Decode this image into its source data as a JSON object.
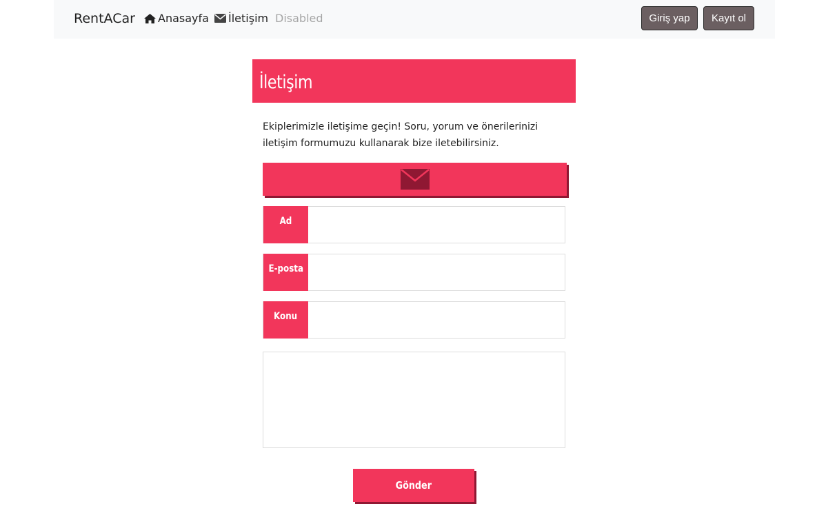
{
  "navbar": {
    "brand": "RentACar",
    "links": [
      {
        "label": "Anasayfa",
        "icon": "home-icon"
      },
      {
        "label": "İletişim",
        "icon": "envelope-icon"
      },
      {
        "label": "Disabled"
      }
    ],
    "login_label": "Giriş yap",
    "register_label": "Kayıt ol"
  },
  "page": {
    "title": "İletişim",
    "intro": "Ekiplerimizle iletişime geçin! Soru, yorum ve önerilerinizi iletişim formumuzu kullanarak bize iletebilirsiniz.",
    "mail_icon": "envelope-icon"
  },
  "form": {
    "fields": [
      {
        "label": "Ad",
        "value": ""
      },
      {
        "label": "E-posta",
        "value": ""
      },
      {
        "label": "Konu",
        "value": ""
      }
    ],
    "message_value": "",
    "submit_label": "Gönder"
  },
  "colors": {
    "accent": "#f2365b",
    "accent_shadow": "#8f1833",
    "navbar_bg": "#f8f9fa",
    "button_bg": "#6b5f61"
  }
}
